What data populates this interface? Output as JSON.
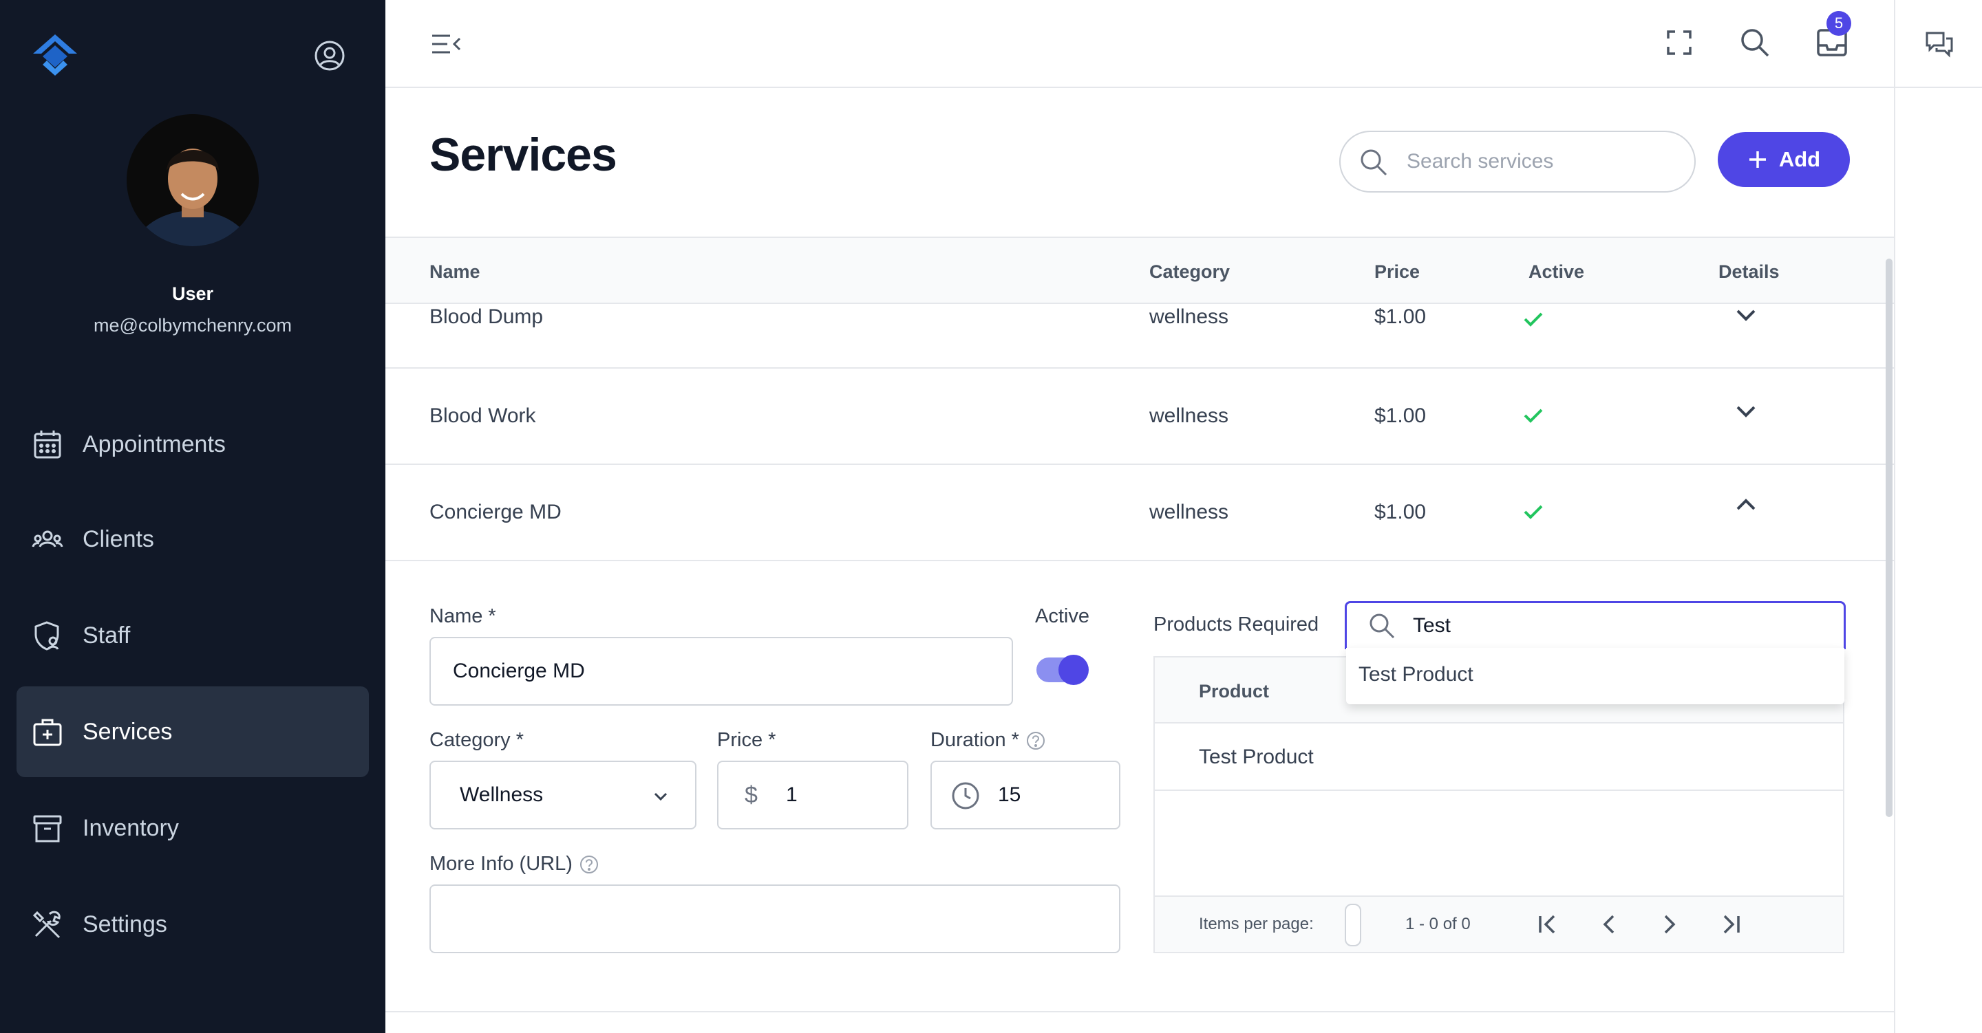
{
  "sidebar": {
    "user_name": "User",
    "user_email": "me@colbymchenry.com",
    "items": [
      {
        "label": "Appointments",
        "icon": "calendar-icon"
      },
      {
        "label": "Clients",
        "icon": "users-icon"
      },
      {
        "label": "Staff",
        "icon": "shield-user-icon"
      },
      {
        "label": "Services",
        "icon": "medical-bag-icon",
        "active": true
      },
      {
        "label": "Inventory",
        "icon": "archive-icon"
      },
      {
        "label": "Settings",
        "icon": "tools-icon"
      }
    ]
  },
  "topbar": {
    "notification_count": "5",
    "icons": [
      "menu-collapse-icon",
      "fullscreen-icon",
      "search-icon",
      "inbox-icon",
      "chat-icon"
    ]
  },
  "page": {
    "title": "Services",
    "search_placeholder": "Search services",
    "add_label": "Add"
  },
  "table": {
    "columns": [
      "Name",
      "Category",
      "Price",
      "Active",
      "Details"
    ],
    "rows": [
      {
        "name": "Blood Dump",
        "category": "wellness",
        "price": "$1.00",
        "active": true,
        "expanded": false
      },
      {
        "name": "Blood Work",
        "category": "wellness",
        "price": "$1.00",
        "active": true,
        "expanded": false
      },
      {
        "name": "Concierge MD",
        "category": "wellness",
        "price": "$1.00",
        "active": true,
        "expanded": true
      }
    ]
  },
  "detail": {
    "name_label": "Name *",
    "name_value": "Concierge MD",
    "active_label": "Active",
    "active_on": true,
    "category_label": "Category *",
    "category_value": "Wellness",
    "price_label": "Price *",
    "price_prefix": "$",
    "price_value": "1",
    "duration_label": "Duration *",
    "duration_value": "15",
    "more_info_label": "More Info (URL)",
    "more_info_value": "",
    "products_label": "Products Required",
    "product_search_value": "Test",
    "dropdown_option": "Test Product",
    "product_column": "Product",
    "product_rows": [
      "Test Product"
    ],
    "items_per_page_label": "Items per page:",
    "range_label": "1 - 0 of 0"
  },
  "colors": {
    "sidebar_bg": "#111827",
    "accent": "#4f46e5",
    "check": "#22c55e"
  }
}
